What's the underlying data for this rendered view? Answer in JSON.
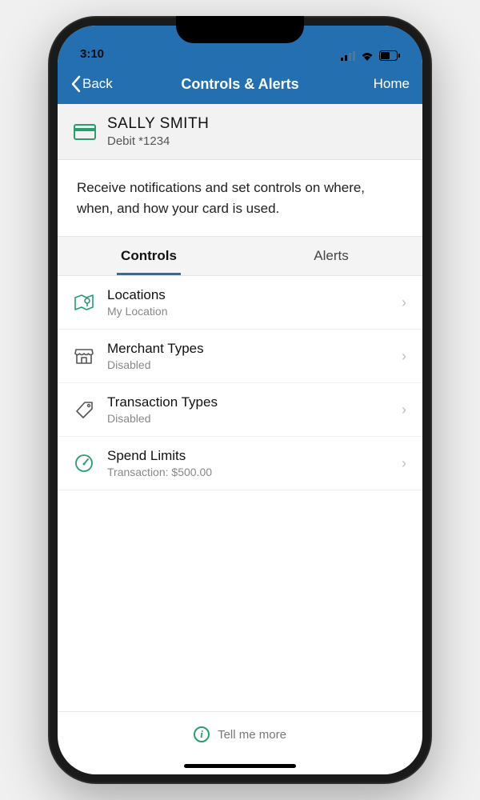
{
  "statusBar": {
    "time": "3:10"
  },
  "nav": {
    "back": "Back",
    "title": "Controls & Alerts",
    "home": "Home"
  },
  "card": {
    "name": "SALLY SMITH",
    "sub": "Debit  *1234"
  },
  "description": "Receive notifications and set controls on where, when, and how your card is used.",
  "tabs": {
    "controls": "Controls",
    "alerts": "Alerts"
  },
  "items": [
    {
      "title": "Locations",
      "sub": "My Location"
    },
    {
      "title": "Merchant Types",
      "sub": "Disabled"
    },
    {
      "title": "Transaction Types",
      "sub": "Disabled"
    },
    {
      "title": "Spend Limits",
      "sub": "Transaction: $500.00"
    }
  ],
  "footer": {
    "label": "Tell me more"
  }
}
